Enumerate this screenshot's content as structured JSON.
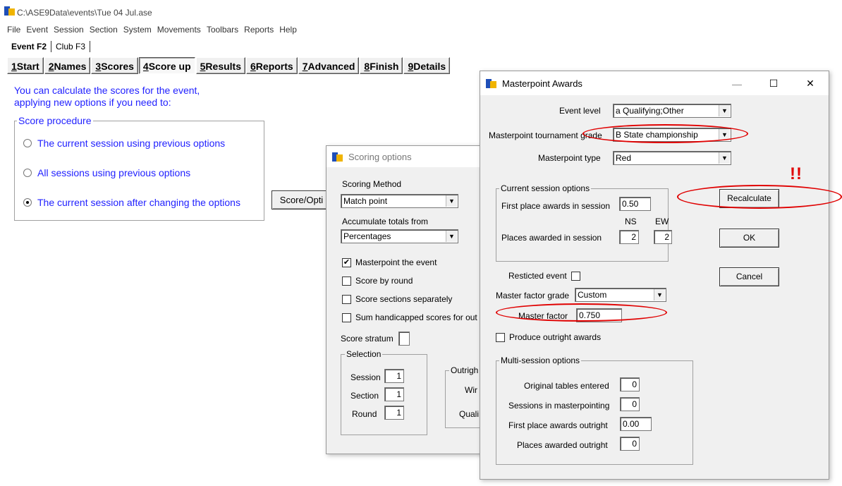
{
  "app": {
    "title": "C:\\ASE9Data\\events\\Tue 04 Jul.ase",
    "menu": [
      "File",
      "Event",
      "Session",
      "Section",
      "System",
      "Movements",
      "Toolbars",
      "Reports",
      "Help"
    ],
    "top_tabs": [
      "Event F2",
      "Club F3"
    ],
    "tabs": [
      {
        "hot": "1",
        "rest": "Start"
      },
      {
        "hot": "2",
        "rest": "Names"
      },
      {
        "hot": "3",
        "rest": "Scores"
      },
      {
        "hot": "4",
        "rest": "Score up"
      },
      {
        "hot": "5",
        "rest": "Results"
      },
      {
        "hot": "6",
        "rest": "Reports"
      },
      {
        "hot": "7",
        "rest": "Advanced"
      },
      {
        "hot": "8",
        "rest": "Finish"
      },
      {
        "hot": "9",
        "rest": "Details"
      }
    ],
    "active_tab": "4Score up"
  },
  "scoreup": {
    "intro_line1": "You can calculate the scores for the event,",
    "intro_line2": "applying new options if you need to:",
    "procedure_legend": "Score procedure",
    "options": [
      {
        "label": "The current session using previous options",
        "selected": false
      },
      {
        "label": "All  sessions using previous options",
        "selected": false
      },
      {
        "label": "The current session after changing the options",
        "selected": true
      }
    ],
    "score_button": "Score/Opti"
  },
  "scoring_options": {
    "title": "Scoring options",
    "scoring_method_label": "Scoring Method",
    "scoring_method_value": "Match point",
    "accumulate_label": "Accumulate totals from",
    "accumulate_value": "Percentages",
    "checks": [
      {
        "label": "Masterpoint the event",
        "checked": true
      },
      {
        "label": "Score by round",
        "checked": false
      },
      {
        "label": "Score sections separately",
        "checked": false
      },
      {
        "label": "Sum handicapped scores for out",
        "checked": false
      }
    ],
    "score_stratum_label": "Score stratum",
    "score_stratum_value": "",
    "selection_legend": "Selection",
    "session_label": "Session",
    "session_value": "1",
    "section_label": "Section",
    "section_value": "1",
    "round_label": "Round",
    "round_value": "1",
    "outright_legend": "Outrigh",
    "win_label": "Wir",
    "quali_label": "Quali"
  },
  "masterpoint": {
    "title": "Masterpoint Awards",
    "event_level_label": "Event level",
    "event_level_value": "a Qualifying;Other",
    "tournament_grade_label": "Masterpoint tournament grade",
    "tournament_grade_value": "B  State championship",
    "type_label": "Masterpoint type",
    "type_value": "Red",
    "current_legend": "Current session options",
    "first_place_label": "First place awards in session",
    "first_place_value": "0.50",
    "ns_label": "NS",
    "ew_label": "EW",
    "places_label": "Places awarded in session",
    "places_ns": "2",
    "places_ew": "2",
    "restricted_label": "Resticted event",
    "restricted_checked": false,
    "factor_grade_label": "Master factor grade",
    "factor_grade_value": "Custom",
    "master_factor_label": "Master factor",
    "master_factor_value": "0.750",
    "produce_outright_label": "Produce outright awards",
    "produce_outright_checked": false,
    "multi_legend": "Multi-session options",
    "orig_tables_label": "Original tables entered",
    "orig_tables_value": "0",
    "sessions_mp_label": "Sessions in masterpointing",
    "sessions_mp_value": "0",
    "first_outright_label": "First place awards outright",
    "first_outright_value": "0.00",
    "places_outright_label": "Places awarded outright",
    "places_outright_value": "0",
    "recalculate_button": "Recalculate",
    "ok_button": "OK",
    "cancel_button": "Cancel",
    "minimize": "—",
    "maximize": "☐",
    "close": "✕"
  },
  "annotation": {
    "marks": "!!",
    "color": "#e00000"
  }
}
